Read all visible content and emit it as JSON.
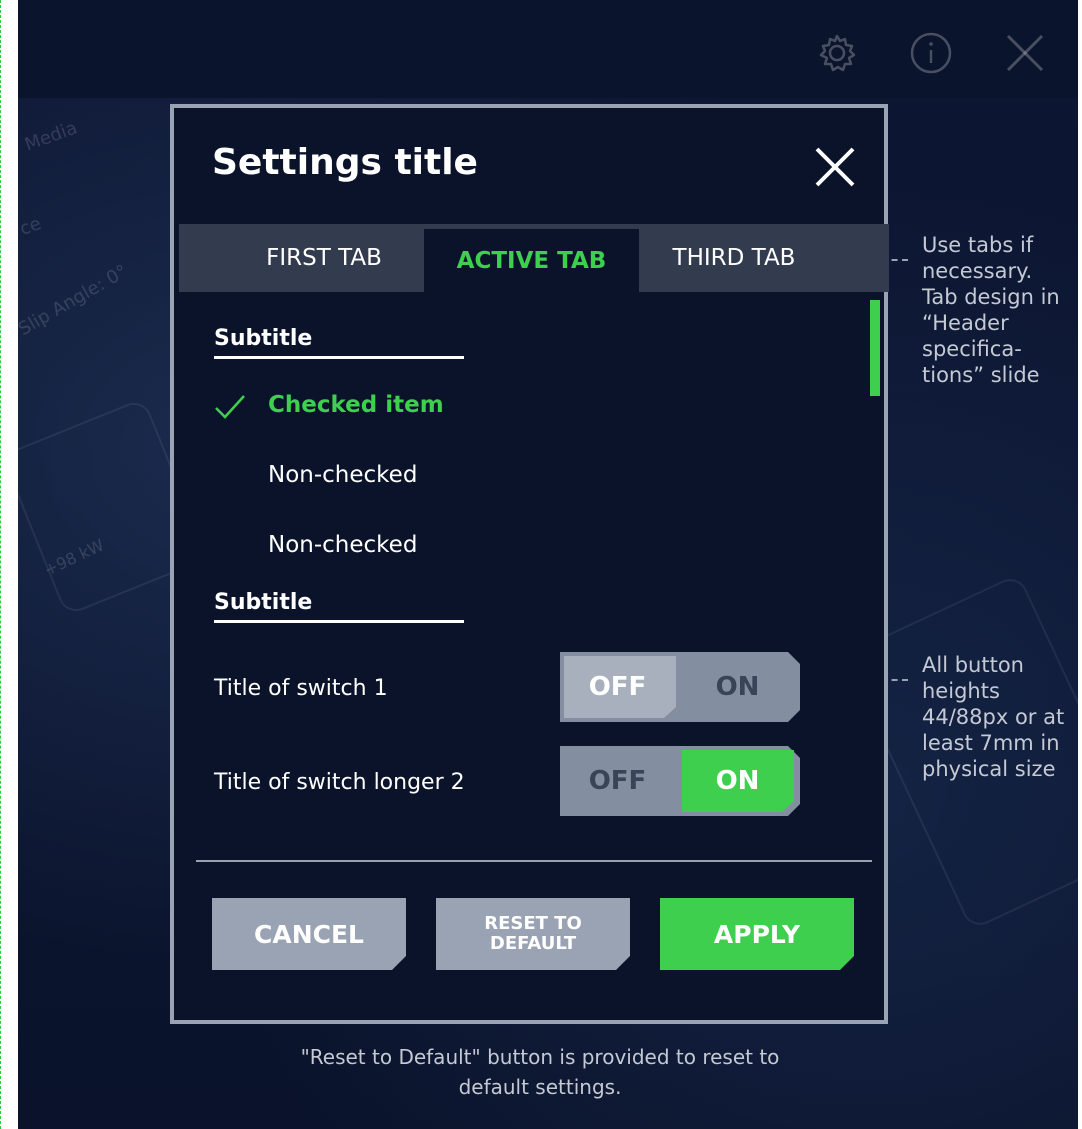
{
  "background": {
    "labels": [
      "Media",
      "ce",
      "Slip Angle: 0°",
      "+98 kW"
    ]
  },
  "topbar": {
    "icons": [
      "gear-icon",
      "info-icon",
      "close-icon"
    ]
  },
  "dialog": {
    "title": "Settings title",
    "tabs": [
      {
        "label": "FIRST TAB",
        "active": false
      },
      {
        "label": "ACTIVE TAB",
        "active": true
      },
      {
        "label": "THIRD TAB",
        "active": false
      }
    ],
    "sections": [
      {
        "subtitle": "Subtitle",
        "items": [
          {
            "label": "Checked item",
            "checked": true
          },
          {
            "label": "Non-checked",
            "checked": false
          },
          {
            "label": "Non-checked",
            "checked": false
          }
        ]
      },
      {
        "subtitle": "Subtitle",
        "switches": [
          {
            "title": "Title of switch 1",
            "off_label": "OFF",
            "on_label": "ON",
            "value": "OFF"
          },
          {
            "title": "Title of switch longer 2",
            "off_label": "OFF",
            "on_label": "ON",
            "value": "ON"
          }
        ]
      }
    ],
    "buttons": {
      "cancel": "CANCEL",
      "reset": "RESET TO DEFAULT",
      "apply": "APPLY"
    }
  },
  "annotations": {
    "tabs_note": "Use tabs if necessary. Tab design in “Header specifica-tions” slide",
    "buttons_note": "All button heights 44/88px or at least 7mm in physical size",
    "footer_note": "\"Reset to Default\" button is provided to reset to default settings."
  },
  "colors": {
    "accent": "#3ecf4f",
    "dialog_bg": "#0a1329",
    "border": "#9aa3b4",
    "tab_bar": "#333b4f",
    "button_grey": "#9aa3b4"
  }
}
